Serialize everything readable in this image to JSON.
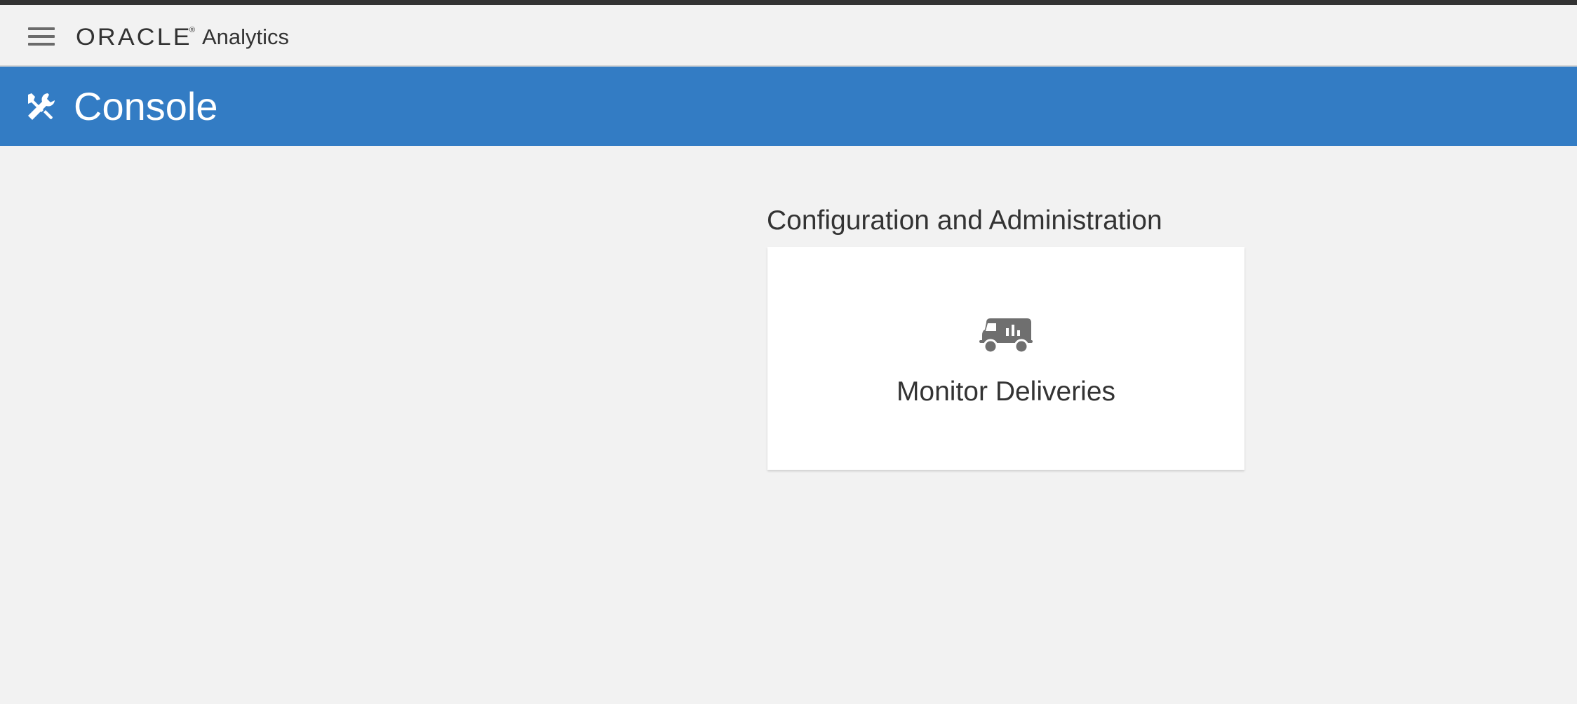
{
  "header": {
    "brand_name": "ORACLE",
    "brand_registered_mark": "®",
    "product_name": "Analytics",
    "menu_icon": "hamburger-menu-icon"
  },
  "page": {
    "title": "Console",
    "title_icon": "tools-icon",
    "banner_color": "#337cc4"
  },
  "sections": [
    {
      "title": "Configuration and Administration",
      "tiles": [
        {
          "label": "Monitor Deliveries",
          "icon": "delivery-truck-icon"
        }
      ]
    }
  ]
}
